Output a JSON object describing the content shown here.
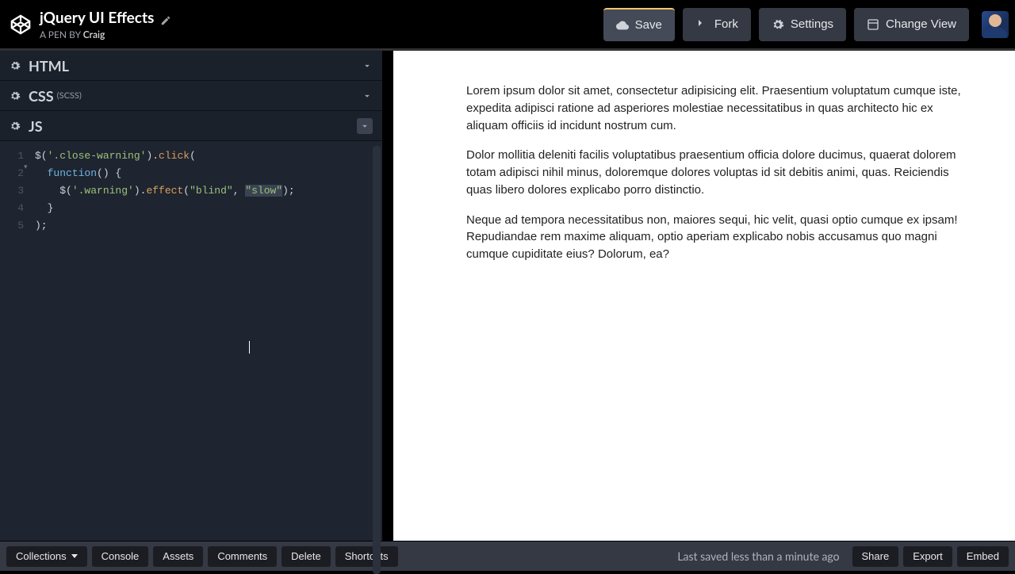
{
  "header": {
    "title": "jQuery UI Effects",
    "byline_prefix": "A PEN BY ",
    "author": "Craig",
    "buttons": {
      "save": "Save",
      "fork": "Fork",
      "settings": "Settings",
      "change_view": "Change View"
    }
  },
  "panels": {
    "html": {
      "label": "HTML"
    },
    "css": {
      "label": "CSS",
      "sublabel": "(SCSS)"
    },
    "js": {
      "label": "JS"
    }
  },
  "code": {
    "lines": [
      "1",
      "2",
      "3",
      "4",
      "5"
    ],
    "source": "$('.close-warning').click(\n  function() {\n    $('.warning').effect(\"blind\", \"slow\");\n  }\n);"
  },
  "preview": {
    "p1": "Lorem ipsum dolor sit amet, consectetur adipisicing elit. Praesentium voluptatum cumque iste, expedita adipisci ratione ad asperiores molestiae necessitatibus in quas architecto hic ex aliquam officiis id incidunt nostrum cum.",
    "p2": "Dolor mollitia deleniti facilis voluptatibus praesentium officia dolore ducimus, quaerat dolorem totam adipisci nihil minus, doloremque dolores voluptas id sit debitis animi, quas. Reiciendis quas libero dolores explicabo porro distinctio.",
    "p3": "Neque ad tempora necessitatibus non, maiores sequi, hic velit, quasi optio cumque ex ipsam! Repudiandae rem maxime aliquam, optio aperiam explicabo nobis accusamus quo magni cumque cupiditate eius? Dolorum, ea?"
  },
  "footer": {
    "collections": "Collections",
    "console": "Console",
    "assets": "Assets",
    "comments": "Comments",
    "delete": "Delete",
    "shortcuts": "Shortcuts",
    "save_status": "Last saved less than a minute ago",
    "share": "Share",
    "export": "Export",
    "embed": "Embed"
  }
}
